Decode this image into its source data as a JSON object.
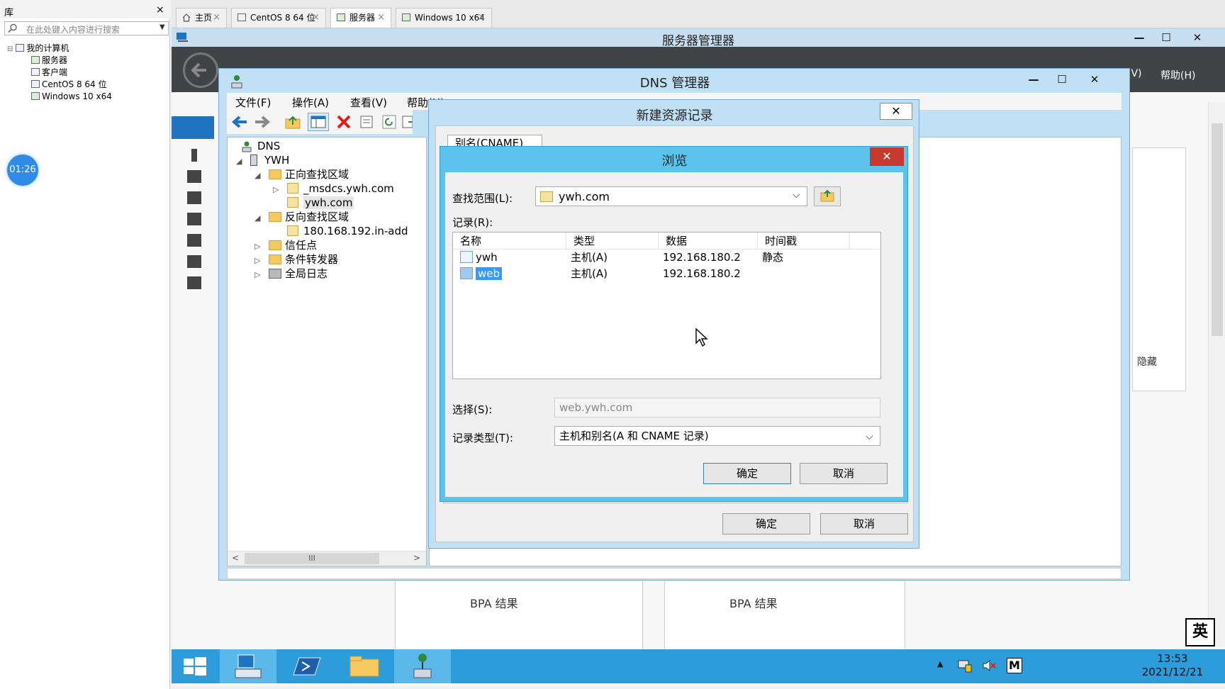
{
  "library": {
    "title": "库",
    "close": "×",
    "search_placeholder": "在此处键入内容进行搜索",
    "tree": [
      {
        "label": "我的计算机"
      },
      {
        "label": "服务器"
      },
      {
        "label": "客户端"
      },
      {
        "label": "CentOS 8 64 位"
      },
      {
        "label": "Windows 10 x64"
      }
    ],
    "timer": "01:26"
  },
  "tabs": [
    {
      "label": "主页"
    },
    {
      "label": "CentOS 8 64 位"
    },
    {
      "label": "服务器"
    },
    {
      "label": "Windows 10 x64"
    }
  ],
  "tab_close": "×",
  "server_manager": {
    "title": "服务器管理器",
    "menu_view_suffix": "(V)",
    "menu_help": "帮助(H)",
    "hide": "隐藏",
    "bpa1": "BPA 结果",
    "bpa2": "BPA 结果"
  },
  "window_buttons": {
    "minimize": "—",
    "maximize": "☐",
    "close": "✕"
  },
  "dns": {
    "title": "DNS 管理器",
    "menu": [
      "文件(F)",
      "操作(A)",
      "查看(V)",
      "帮助(H)"
    ],
    "tree": {
      "root": "DNS",
      "server": "YWH",
      "forward": "正向查找区域",
      "msdcs": "_msdcs.ywh.com",
      "zone": "ywh.com",
      "reverse": "反向查找区域",
      "reverse_zone": "180.168.192.in-add",
      "trust": "信任点",
      "forwarders": "条件转发器",
      "global_logs": "全局日志"
    },
    "hscroll_mark": "III"
  },
  "new_record": {
    "title": "新建资源记录",
    "tab": "别名(CNAME)",
    "ok": "确定",
    "cancel": "取消",
    "close": "✕"
  },
  "browse": {
    "title": "浏览",
    "close": "✕",
    "scope_label": "查找范围(L):",
    "scope_value": "ywh.com",
    "records_label": "记录(R):",
    "columns": [
      "名称",
      "类型",
      "数据",
      "时间戳"
    ],
    "records": [
      {
        "name": "ywh",
        "type": "主机(A)",
        "data": "192.168.180.2",
        "timestamp": "静态"
      },
      {
        "name": "web",
        "type": "主机(A)",
        "data": "192.168.180.2",
        "timestamp": ""
      }
    ],
    "selection_label": "选择(S):",
    "selection_value": "web.ywh.com",
    "record_type_label": "记录类型(T):",
    "record_type_value": "主机和别名(A 和 CNAME 记录)",
    "ok": "确定",
    "cancel": "取消"
  },
  "taskbar": {
    "time": "13:53",
    "date": "2021/12/21",
    "ime": "英",
    "tray_m": "M",
    "tray_arrow": "▲"
  },
  "colors": {
    "browse_title_bg": "#5cc4ec",
    "dialog_bg": "#bfe0f5",
    "taskbar_bg": "#2d9cdb",
    "selection": "#3399ff",
    "close_red": "#c6392e"
  }
}
